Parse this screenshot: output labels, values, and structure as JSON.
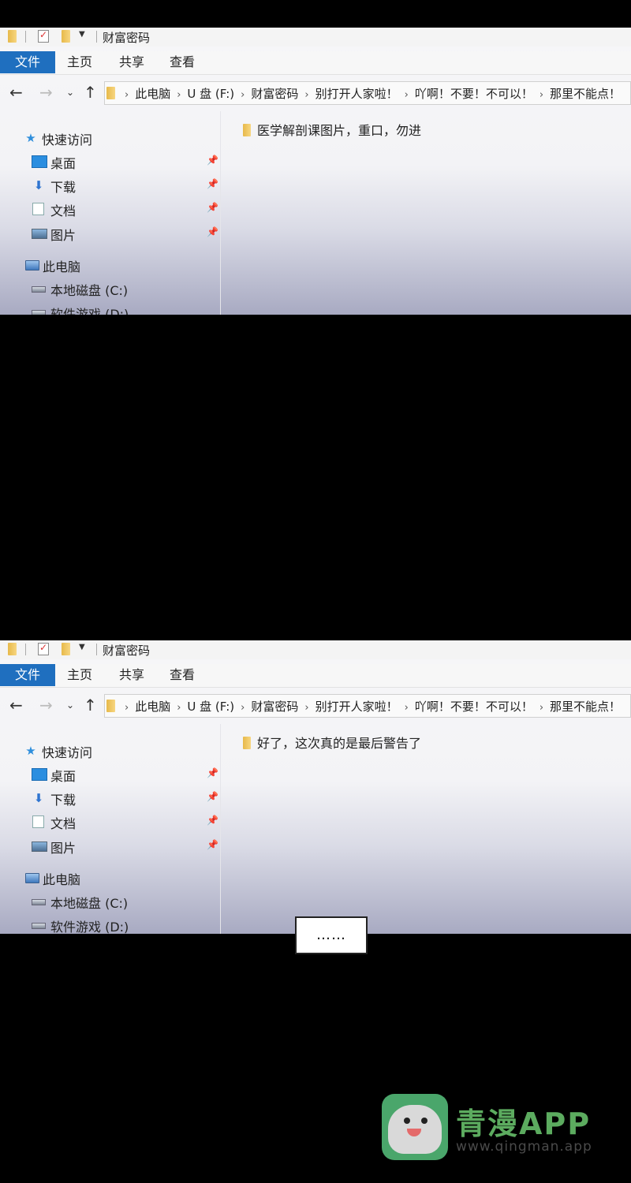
{
  "window": {
    "title": "财富密码",
    "ribbon_tabs": [
      "文件",
      "主页",
      "共享",
      "查看"
    ]
  },
  "breadcrumb": [
    "此电脑",
    "U 盘 (F:)",
    "财富密码",
    "别打开人家啦！",
    "吖啊！不要！不可以！",
    "那里不能点！"
  ],
  "nav_pane": {
    "quick_access": "快速访问",
    "pinned": [
      {
        "label": "桌面",
        "icon": "desktop-icon"
      },
      {
        "label": "下载",
        "icon": "download-icon"
      },
      {
        "label": "文档",
        "icon": "documents-icon"
      },
      {
        "label": "图片",
        "icon": "pictures-icon"
      }
    ],
    "this_pc": "此电脑",
    "drives": [
      {
        "label": "本地磁盘 (C:)"
      },
      {
        "label": "软件游戏 (D:)"
      }
    ]
  },
  "panels": [
    {
      "file_item": "医学解剖课图片，重口，勿进"
    },
    {
      "file_item": "好了，这次真的是最后警告了"
    }
  ],
  "speech": "……",
  "watermark": {
    "brand": "青漫APP",
    "url": "www.qingman.app"
  },
  "colors": {
    "file_tab": "#1f6fbf",
    "watermark_green": "#5cab5f"
  }
}
